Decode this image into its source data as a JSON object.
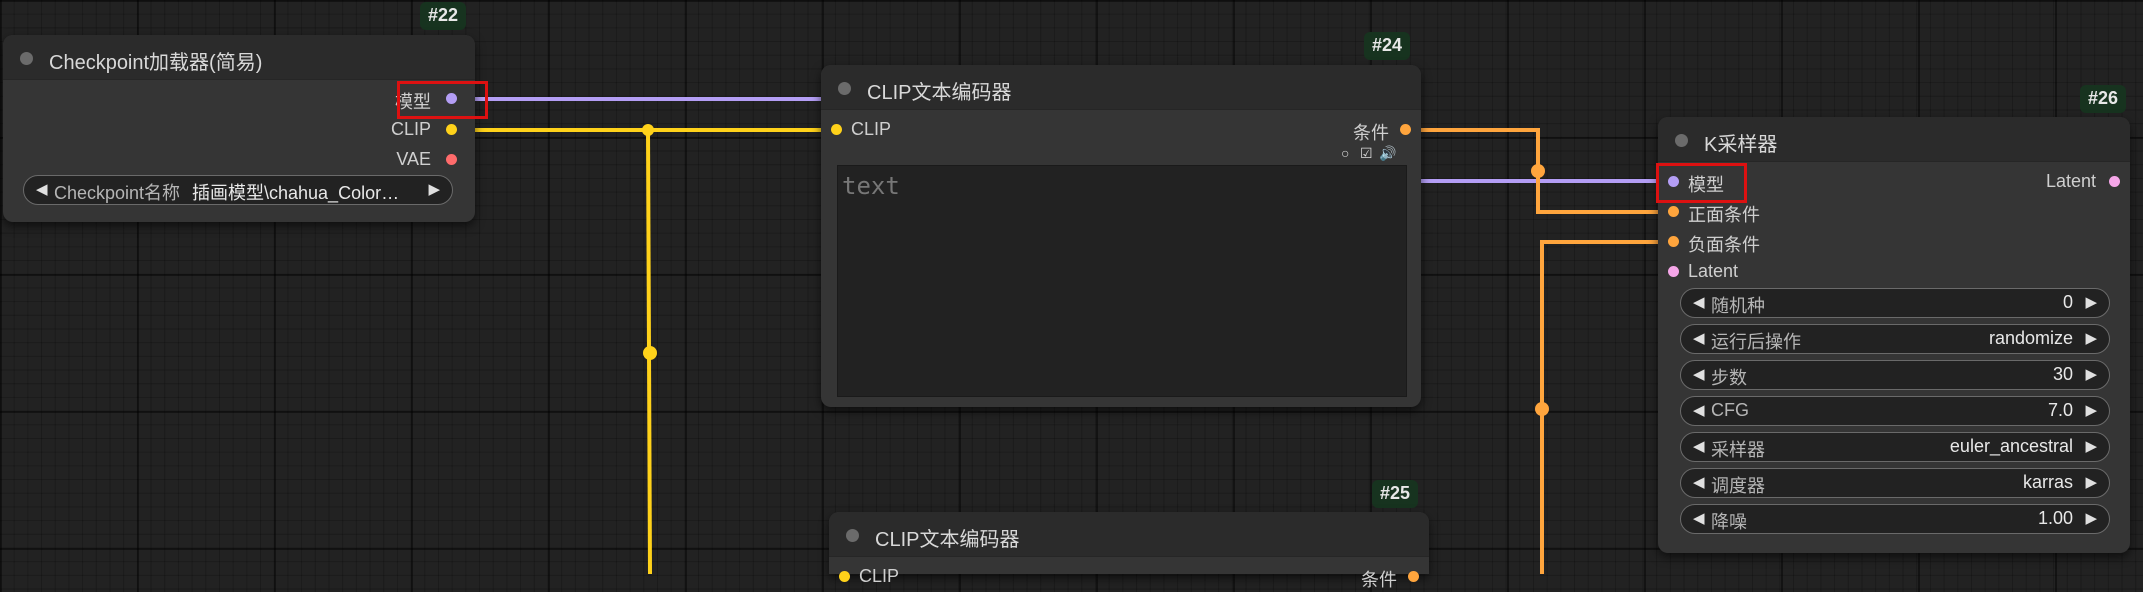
{
  "nodes": {
    "checkpoint_loader": {
      "id": "#22",
      "title": "Checkpoint加载器(简易)",
      "outputs": [
        "模型",
        "CLIP",
        "VAE"
      ],
      "widget": {
        "label": "Checkpoint名称",
        "value": "插画模型\\chahua_Color…"
      }
    },
    "clip_encoder_24": {
      "id": "#24",
      "title": "CLIP文本编码器",
      "input": "CLIP",
      "output": "条件",
      "placeholder": "text"
    },
    "clip_encoder_25": {
      "id": "#25",
      "title": "CLIP文本编码器",
      "input": "CLIP",
      "output": "条件"
    },
    "ksampler": {
      "id": "#26",
      "title": "K采样器",
      "inputs": [
        "模型",
        "正面条件",
        "负面条件",
        "Latent"
      ],
      "output": "Latent",
      "widgets": [
        {
          "label": "随机种",
          "value": "0"
        },
        {
          "label": "运行后操作",
          "value": "randomize"
        },
        {
          "label": "步数",
          "value": "30"
        },
        {
          "label": "CFG",
          "value": "7.0"
        },
        {
          "label": "采样器",
          "value": "euler_ancestral"
        },
        {
          "label": "调度器",
          "value": "karras"
        },
        {
          "label": "降噪",
          "value": "1.00"
        }
      ]
    }
  },
  "colors": {
    "model_wire": "#b49ef5",
    "clip_wire": "#ffd21a",
    "conditioning_wire": "#ffa53d",
    "highlight": "#dd1111"
  },
  "icons": [
    "circle-toggle-icon",
    "checkbox-icon",
    "speaker-icon",
    "arrow-left-icon",
    "arrow-right-icon"
  ]
}
